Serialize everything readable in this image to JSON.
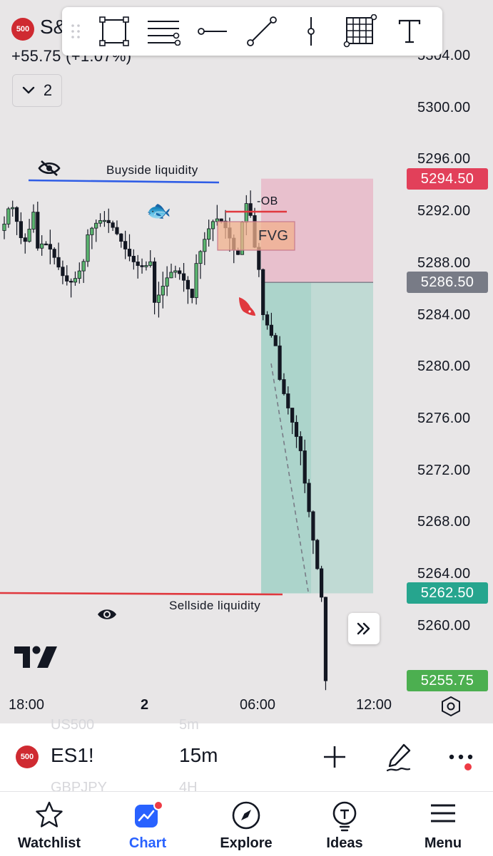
{
  "header": {
    "symbol_logo": "500",
    "symbol_short": "S&",
    "price_change": "+55.75 (+1.07%)",
    "collapse_count": "2"
  },
  "drawing_toolbar": {
    "tools": [
      "rectangle-icon",
      "fib-levels-icon",
      "horizontal-ray-icon",
      "trend-line-icon",
      "vertical-line-icon",
      "grid-icon",
      "text-icon"
    ]
  },
  "price_axis": {
    "labels": [
      "5304.00",
      "5300.00",
      "5296.00",
      "5292.00",
      "5288.00",
      "5284.00",
      "5280.00",
      "5276.00",
      "5272.00",
      "5268.00",
      "5264.00",
      "5260.00"
    ],
    "range": [
      5252.6,
      5305.4
    ]
  },
  "price_tags": {
    "target": {
      "label": "5294.50",
      "color": "#e2405a"
    },
    "entry": {
      "label": "5286.50",
      "color": "#787b86"
    },
    "stop": {
      "label": "5262.50",
      "color": "#26a58e"
    },
    "last": {
      "label": "5255.75",
      "color": "#4caf50"
    }
  },
  "time_axis": {
    "labels": [
      "18:00",
      "2",
      "06:00",
      "12:00"
    ]
  },
  "annotations": {
    "buyside": "Buyside liquidity",
    "sellside": "Sellside liquidity",
    "ob": "-OB",
    "fvg": "FVG",
    "fish_emoji": "🐟"
  },
  "colors": {
    "chart_bg": "#e8e6e7",
    "candle_up": "#5bb56f",
    "candle_down": "#131722",
    "buyside_line": "#2f5de6",
    "sellside_line": "#e0383e",
    "target_zone": "#e7b9c8",
    "stop_zone": "#9fd0c4",
    "fvg_fill": "#f2b08c"
  },
  "symbol_bar": {
    "logo": "500",
    "symbol": "ES1!",
    "interval": "15m",
    "ghost_prev_symbol": "US500",
    "ghost_prev_interval": "5m",
    "ghost_next_symbol": "GBPJPY",
    "ghost_next_interval": "4H"
  },
  "bottom_nav": {
    "items": [
      {
        "label": "Watchlist",
        "icon": "star-icon"
      },
      {
        "label": "Chart",
        "icon": "chart-icon"
      },
      {
        "label": "Explore",
        "icon": "compass-icon"
      },
      {
        "label": "Ideas",
        "icon": "lightbulb-icon"
      },
      {
        "label": "Menu",
        "icon": "menu-icon"
      }
    ],
    "active_index": 1
  }
}
